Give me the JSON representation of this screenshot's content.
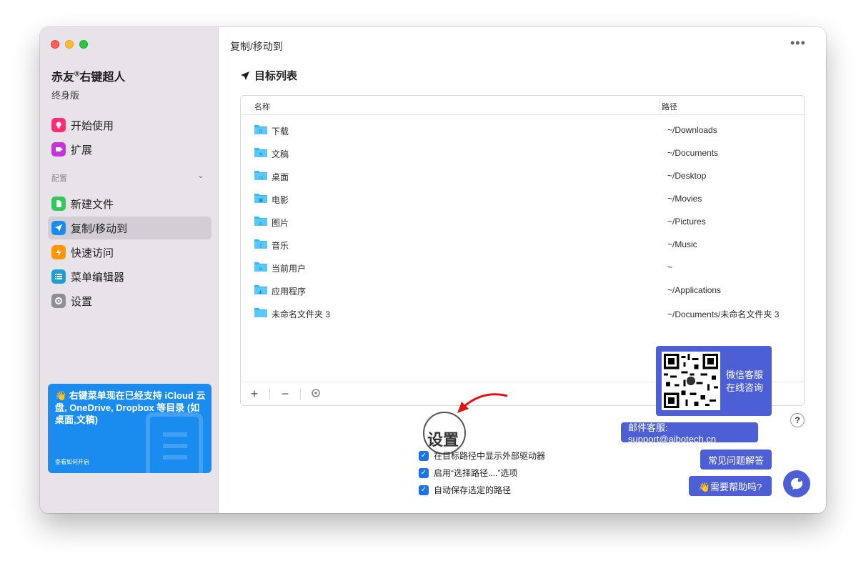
{
  "app": {
    "name": "赤友",
    "reg_mark": "®",
    "name_suffix": "右键超人",
    "edition": "终身版"
  },
  "sidebar": {
    "items_top": [
      {
        "label": "开始使用",
        "icon": "lightbulb-icon",
        "color": "#ff2d78"
      },
      {
        "label": "扩展",
        "icon": "puzzle-icon",
        "color": "#c435d9"
      }
    ],
    "section_label": "配置",
    "items_config": [
      {
        "label": "新建文件",
        "icon": "new-file-icon",
        "color": "#34c759"
      },
      {
        "label": "复制/移动到",
        "icon": "send-icon",
        "color": "#1a8cf0",
        "active": true
      },
      {
        "label": "快速访问",
        "icon": "lightning-icon",
        "color": "#ff9500"
      },
      {
        "label": "菜单编辑器",
        "icon": "list-icon",
        "color": "#1aa0d8"
      },
      {
        "label": "设置",
        "icon": "gear-icon",
        "color": "#8e8e93"
      }
    ],
    "promo": {
      "text": "👋 右键菜单现在已经支持 iCloud 云盘, OneDrive, Dropbox 等目录 (如桌面,文稿)",
      "link": "查看如何开启"
    }
  },
  "main": {
    "title": "复制/移动到",
    "section_title": "目标列表",
    "columns": {
      "name": "名称",
      "path": "路径"
    },
    "rows": [
      {
        "name": "下载",
        "path": "~/Downloads"
      },
      {
        "name": "文稿",
        "path": "~/Documents"
      },
      {
        "name": "桌面",
        "path": "~/Desktop"
      },
      {
        "name": "电影",
        "path": "~/Movies"
      },
      {
        "name": "图片",
        "path": "~/Pictures"
      },
      {
        "name": "音乐",
        "path": "~/Music"
      },
      {
        "name": "当前用户",
        "path": "~"
      },
      {
        "name": "应用程序",
        "path": "~/Applications"
      },
      {
        "name": "未命名文件夹 3",
        "path": "~/Documents/未命名文件夹 3"
      }
    ],
    "toolbar": {
      "add": "+",
      "remove": "−"
    },
    "settings_label": "设置",
    "options": [
      {
        "label": "在目标路径中显示外部驱动器",
        "checked": true
      },
      {
        "label": "启用“选择路径....”选项",
        "checked": true
      },
      {
        "label": "自动保存选定的路径",
        "checked": true
      }
    ]
  },
  "support": {
    "qr_line1": "微信客服",
    "qr_line2": "在线咨询",
    "email": "邮件客服: support@aibotech.cn",
    "faq": "常见问题解答",
    "help": "👋需要帮助吗?",
    "question_mark": "?"
  },
  "colors": {
    "accent": "#4c5fd5",
    "promo": "#1a8cf0",
    "highlight": "#e01414",
    "folder": "#5ac8fa"
  }
}
